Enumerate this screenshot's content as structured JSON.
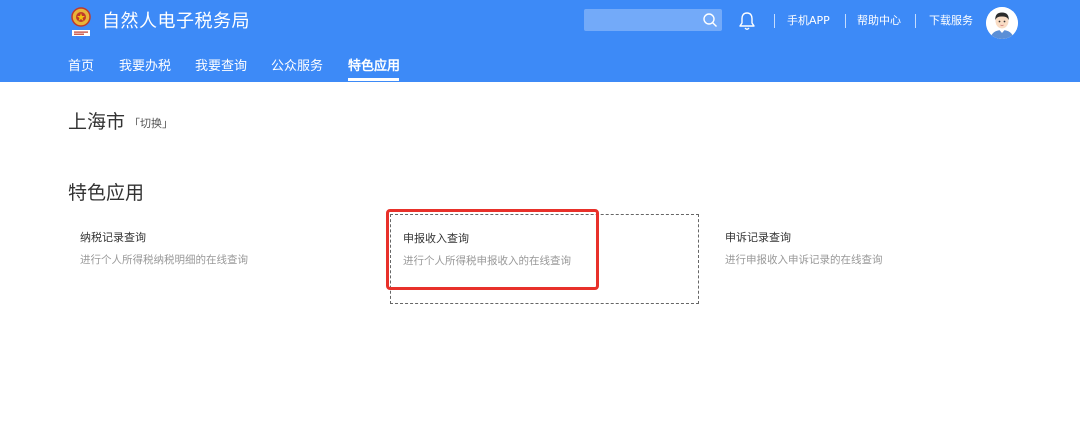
{
  "header": {
    "title": "自然人电子税务局",
    "search": {
      "placeholder": ""
    },
    "utility_links": [
      "手机APP",
      "帮助中心",
      "下载服务"
    ]
  },
  "nav": {
    "tabs": [
      {
        "label": "首页"
      },
      {
        "label": "我要办税"
      },
      {
        "label": "我要查询"
      },
      {
        "label": "公众服务"
      },
      {
        "label": "特色应用",
        "active": true
      }
    ]
  },
  "location": {
    "city": "上海市",
    "switch_label": "「切换」"
  },
  "section": {
    "title": "特色应用",
    "cards": [
      {
        "title": "纳税记录查询",
        "desc": "进行个人所得税纳税明细的在线查询"
      },
      {
        "title": "申报收入查询",
        "desc": "进行个人所得税申报收入的在线查询",
        "highlighted": true
      },
      {
        "title": "申诉记录查询",
        "desc": "进行申报收入申诉记录的在线查询"
      }
    ]
  },
  "colors": {
    "header_bg": "#3d8af7",
    "highlight_border": "#e8312a"
  },
  "icons": [
    "tax-emblem-icon",
    "search-icon",
    "bell-icon",
    "user-avatar-icon"
  ]
}
